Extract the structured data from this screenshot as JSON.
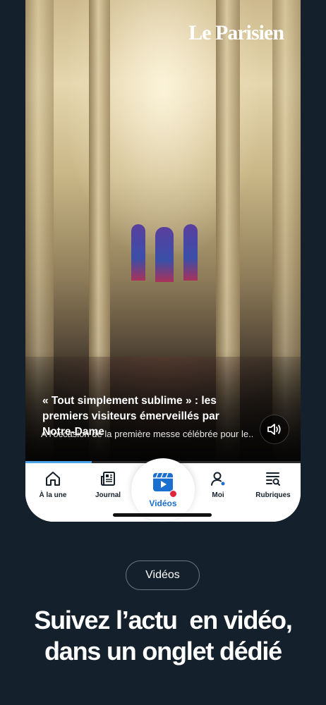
{
  "video": {
    "brand": "Le Parisien",
    "title": "« Tout simplement sublime » : les premiers visiteurs émerveillés par Notre-Dame",
    "subtitle": "A l’occasion de la première messe célébrée pour le...",
    "sound_icon": "speaker-icon",
    "progress": 0.24
  },
  "tabbar": {
    "tabs": [
      {
        "label": "À la une",
        "icon": "home-icon"
      },
      {
        "label": "Journal",
        "icon": "newspaper-icon"
      },
      {
        "label": "Vidéos",
        "icon": "video-play-icon",
        "active": true
      },
      {
        "label": "Moi",
        "icon": "user-icon"
      },
      {
        "label": "Rubriques",
        "icon": "list-search-icon"
      }
    ]
  },
  "promo": {
    "pill_label": "Vidéos",
    "headline_line1": "Suivez l’actu  en vidéo,",
    "headline_line2": "dans un onglet dédié"
  },
  "colors": {
    "background": "#14202b",
    "accent": "#1a6fcf",
    "record_dot": "#e0243b"
  }
}
